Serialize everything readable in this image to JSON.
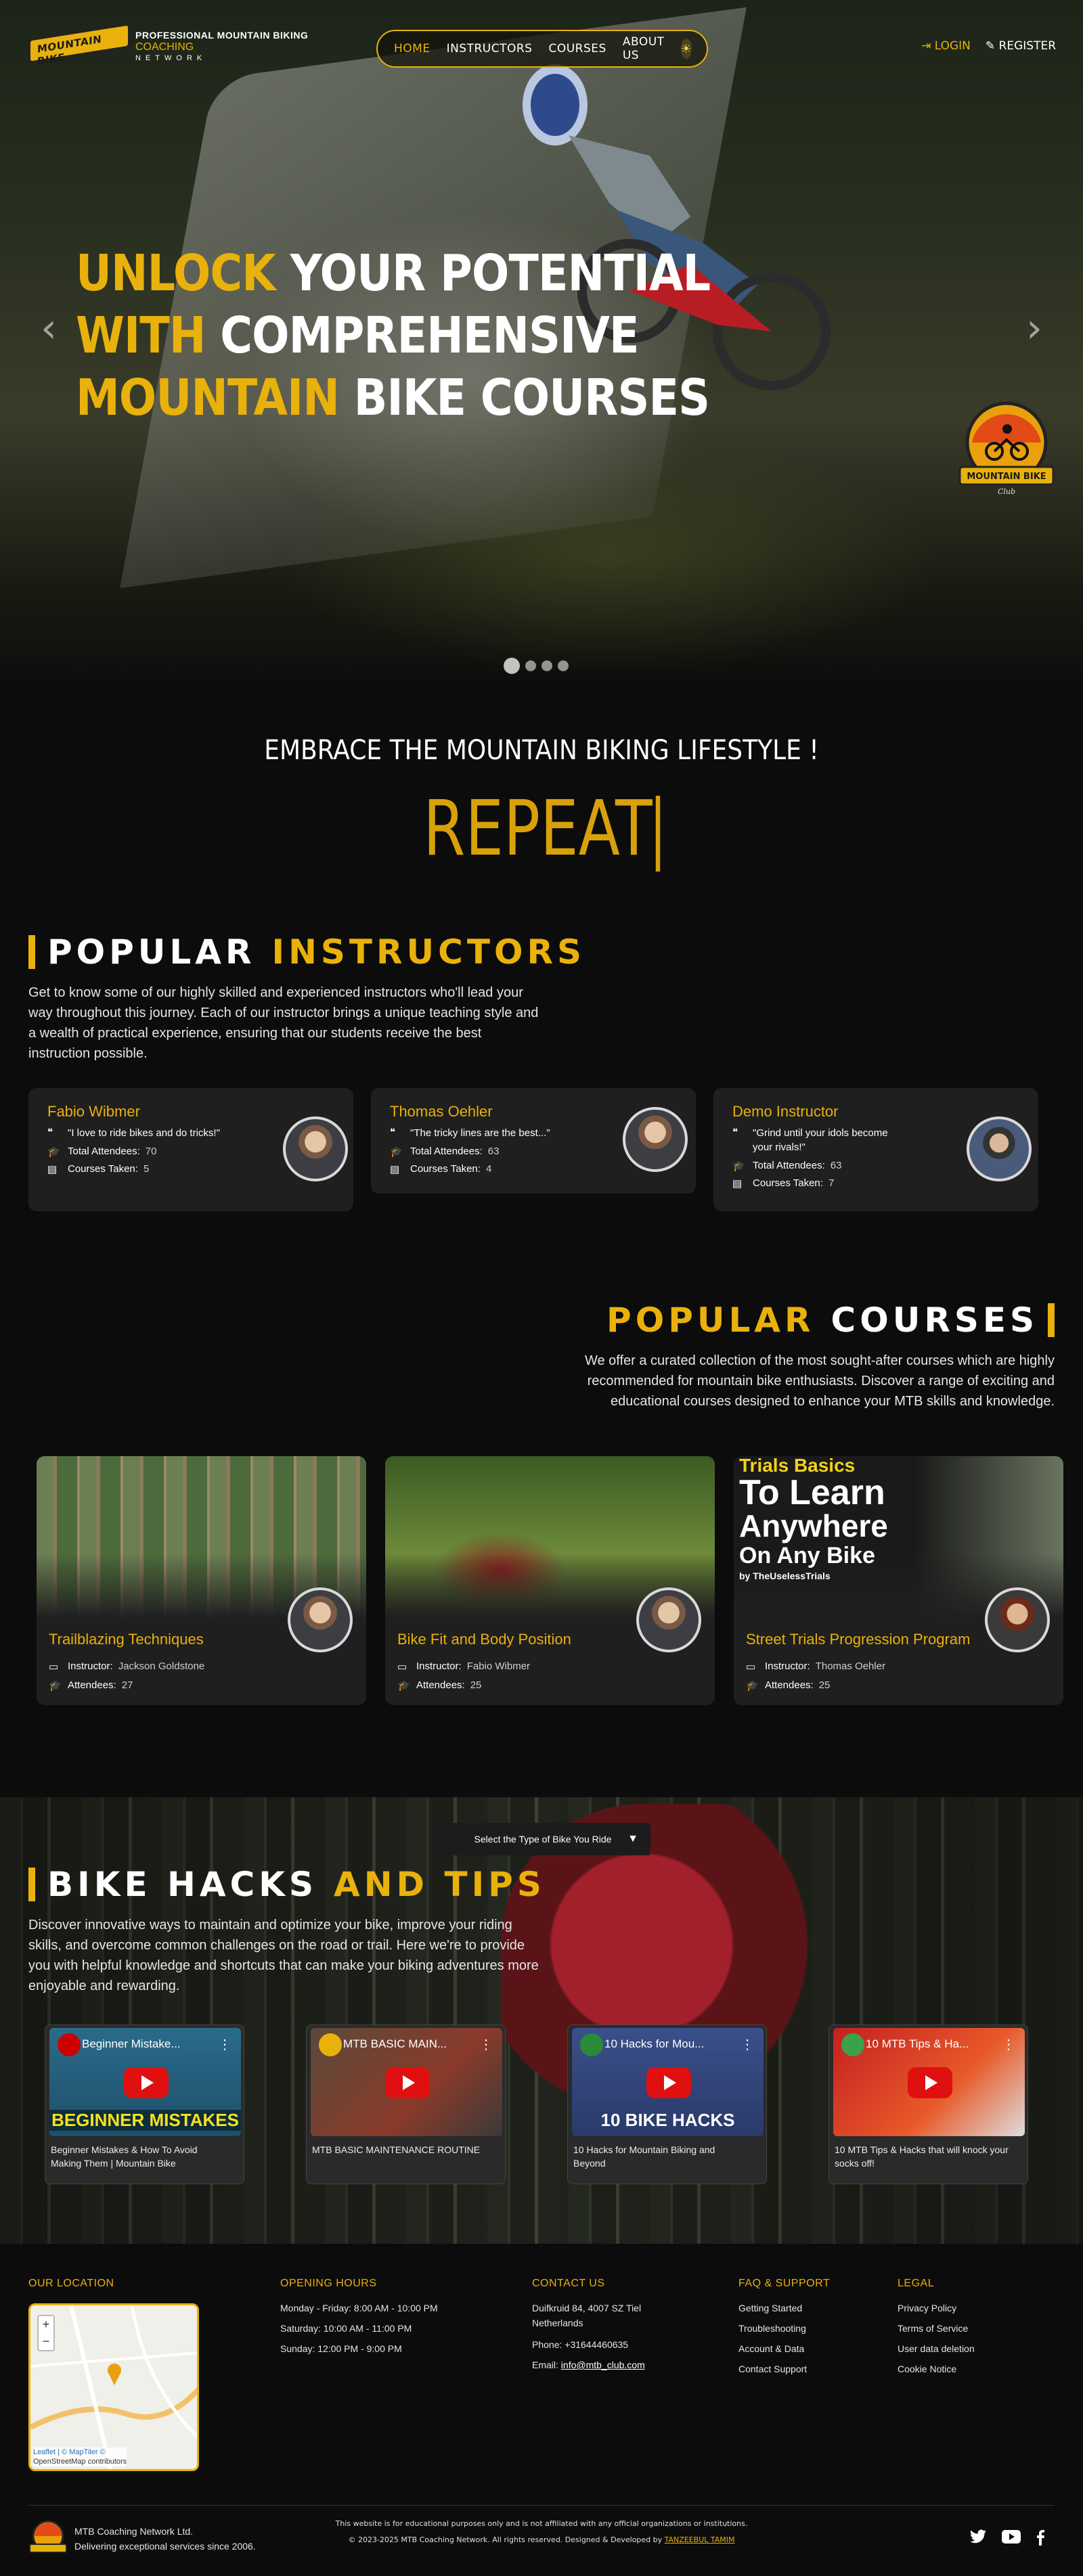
{
  "header": {
    "logo_badge": "MOUNTAIN BIKE",
    "logo_line1": "PROFESSIONAL MOUNTAIN BIKING",
    "logo_line2": "COACHING",
    "logo_line3": "NETWORK",
    "nav": [
      "HOME",
      "INSTRUCTORS",
      "COURSES",
      "ABOUT US"
    ],
    "login": "LOGIN",
    "register": "REGISTER"
  },
  "hero": {
    "title": [
      [
        "UNLOCK",
        " YOUR POTENTIAL"
      ],
      [
        "WITH",
        " COMPREHENSIVE"
      ],
      [
        "MOUNTAIN",
        " BIKE COURSES"
      ]
    ],
    "badge_text": "MOUNTAIN BIKE",
    "badge_sub": "Club",
    "prev": "‹",
    "next": "›",
    "slides": 4,
    "active_slide": 1
  },
  "embrace": {
    "heading": "EMBRACE THE MOUNTAIN BIKING LIFESTYLE !",
    "typed": "REPEAT"
  },
  "instructors": {
    "title_white": "POPULAR",
    "title_yellow": "INSTRUCTORS",
    "description": "Get to know some of our highly skilled and experienced instructors who'll lead your way throughout this journey. Each of our instructor brings a unique teaching style and a wealth of practical experience, ensuring that our students receive the best instruction possible.",
    "attendees_label": "Total Attendees:",
    "courses_label": "Courses Taken:",
    "cards": [
      {
        "name": "Fabio Wibmer",
        "quote": "\"I love to ride bikes and do tricks!\"",
        "attendees": "70",
        "courses": "5"
      },
      {
        "name": "Thomas Oehler",
        "quote": "\"The tricky lines are the best...\"",
        "attendees": "63",
        "courses": "4"
      },
      {
        "name": "Demo Instructor",
        "quote": "\"Grind until your idols become your rivals!\"",
        "attendees": "63",
        "courses": "7"
      }
    ]
  },
  "courses": {
    "title_yellow": "POPULAR",
    "title_white": "COURSES",
    "description": "We offer a curated collection of the most sought-after courses which are highly recommended for mountain bike enthusiasts. Discover a range of exciting and educational courses designed to enhance your MTB skills and knowledge.",
    "instructor_label": "Instructor:",
    "attendees_label": "Attendees:",
    "cards": [
      {
        "title": "Trailblazing Techniques",
        "instructor": "Jackson Goldstone",
        "attendees": "27"
      },
      {
        "title": "Bike Fit and Body Position",
        "instructor": "Fabio Wibmer",
        "attendees": "25"
      },
      {
        "title": "Street Trials Progression Program",
        "instructor": "Thomas Oehler",
        "attendees": "25",
        "thumb_line1": "Trials Basics",
        "thumb_line2": "To Learn",
        "thumb_line3": "Anywhere",
        "thumb_line4": "On Any Bike",
        "thumb_line5": "by TheUselessTrials"
      }
    ]
  },
  "hacks": {
    "select_placeholder": "Select the Type of Bike You Ride",
    "select_chevron": "▼",
    "title_white": "BIKE HACKS",
    "title_yellow": "AND TIPS",
    "description": "Discover innovative ways to maintain and optimize your bike, improve your riding skills, and overcome common challenges on the road or trail. Here we're to provide you with helpful knowledge and shortcuts that can make your biking adventures more enjoyable and rewarding.",
    "videos": [
      {
        "title": "Beginner Mistake...",
        "banner": "BEGINNER MISTAKES",
        "caption": "Beginner Mistakes & How To Avoid Making Them | Mountain Bike"
      },
      {
        "title": "MTB BASIC MAIN...",
        "banner": "",
        "caption": "MTB BASIC MAINTENANCE ROUTINE"
      },
      {
        "title": "10 Hacks for Mou...",
        "banner": "10 BIKE HACKS",
        "caption": "10 Hacks for Mountain Biking and Beyond"
      },
      {
        "title": "10 MTB Tips & Ha...",
        "banner": "",
        "caption": "10 MTB Tips & Hacks that will knock your socks off!"
      }
    ]
  },
  "footer": {
    "location_h": "OUR LOCATION",
    "hours_h": "OPENING HOURS",
    "contact_h": "CONTACT US",
    "faq_h": "FAQ & SUPPORT",
    "legal_h": "LEGAL",
    "hours": [
      "Monday - Friday: 8:00 AM - 10:00 PM",
      "Saturday: 10:00 AM - 11:00 PM",
      "Sunday: 12:00 PM - 9:00 PM"
    ],
    "address": "Duifkruid 84, 4007 SZ Tiel Netherlands",
    "phone": "Phone: +31644460635",
    "email_label": "Email: ",
    "email": "info@mtb_club.com",
    "faq": [
      "Getting Started",
      "Troubleshooting",
      "Account & Data",
      "Contact Support"
    ],
    "legal": [
      "Privacy Policy",
      "Terms of Service",
      "User data deletion",
      "Cookie Notice"
    ],
    "map_zoom_in": "+",
    "map_zoom_out": "−",
    "map_attr1": "Leaflet | © MapTiler ©",
    "map_attr2": "OpenStreetMap contributors",
    "disclaimer": "This website is for educational purposes only and is not affiliated with any official organizations or institutions.",
    "copyright": "© 2023-2025 MTB Coaching Network. All rights reserved. Designed & Developed by ",
    "developer": "TANZEEBUL TAMIM",
    "company_name": "MTB Coaching Network Ltd.",
    "company_tagline": "Delivering exceptional services since 2006.",
    "social": [
      "twitter-icon",
      "youtube-icon",
      "facebook-icon"
    ]
  }
}
